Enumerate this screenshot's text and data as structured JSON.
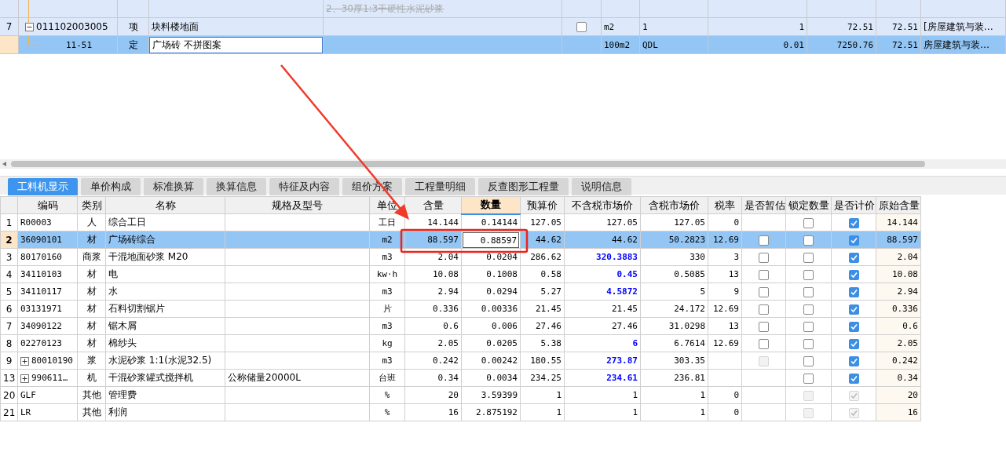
{
  "upper_table": {
    "rows": [
      {
        "kind": "partial",
        "description": "2、30厚1:3干硬性水泥砂浆"
      },
      {
        "kind": "item",
        "number": "7",
        "code": "011102003005",
        "expanded": true,
        "type": "项",
        "name": "块料楼地面",
        "checked": false,
        "unit": "m2",
        "expression": "1",
        "quantity": "1",
        "unit_price": "72.51",
        "total": "72.51",
        "specialty": "[房屋建筑与装…",
        "selected": false
      },
      {
        "kind": "quota",
        "code": "11-51",
        "type": "定",
        "name": "广场砖 不拼图案",
        "unit": "100m2",
        "expression": "QDL",
        "quantity": "0.01",
        "unit_price": "7250.76",
        "total": "72.51",
        "specialty": "房屋建筑与装…",
        "selected": true
      }
    ]
  },
  "tabs": [
    {
      "label": "工料机显示",
      "selected": true
    },
    {
      "label": "单价构成",
      "selected": false
    },
    {
      "label": "标准换算",
      "selected": false
    },
    {
      "label": "换算信息",
      "selected": false
    },
    {
      "label": "特征及内容",
      "selected": false
    },
    {
      "label": "组价方案",
      "selected": false
    },
    {
      "label": "工程量明细",
      "selected": false
    },
    {
      "label": "反查图形工程量",
      "selected": false
    },
    {
      "label": "说明信息",
      "selected": false
    }
  ],
  "resource_table": {
    "columns": [
      {
        "label": "编码",
        "selected": false
      },
      {
        "label": "类别",
        "selected": false
      },
      {
        "label": "名称",
        "selected": false
      },
      {
        "label": "规格及型号",
        "selected": false
      },
      {
        "label": "单位",
        "selected": false
      },
      {
        "label": "含量",
        "selected": false
      },
      {
        "label": "数量",
        "selected": true
      },
      {
        "label": "预算价",
        "selected": false
      },
      {
        "label": "不含税市场价",
        "selected": false
      },
      {
        "label": "含税市场价",
        "selected": false
      },
      {
        "label": "税率",
        "selected": false
      },
      {
        "label": "是否暂估",
        "selected": false
      },
      {
        "label": "锁定数量",
        "selected": false
      },
      {
        "label": "是否计价",
        "selected": false
      },
      {
        "label": "原始含量",
        "selected": false
      }
    ],
    "rows": [
      {
        "number": "1",
        "code": "R00003",
        "expandable": false,
        "type": "人",
        "name": "综合工日",
        "unit": "工日",
        "content": "14.144",
        "quantity": "0.14144",
        "budget_price": "127.05",
        "market_price": "127.05",
        "market_changed": false,
        "market_price_tax": "127.05",
        "tax_rate": "0",
        "lock": {
          "checked": false,
          "disabled": false
        },
        "priced": {
          "checked": true,
          "disabled": false
        },
        "original": "14.144",
        "selected": false
      },
      {
        "number": "2",
        "code": "36090101",
        "expandable": false,
        "type": "材",
        "name": "广场砖综合",
        "unit": "m2",
        "content": "88.597",
        "quantity": "0.88597",
        "budget_price": "44.62",
        "market_price": "44.62",
        "market_changed": false,
        "market_price_tax": "50.2823",
        "tax_rate": "12.69",
        "estimate": {
          "checked": false,
          "disabled": false
        },
        "lock": {
          "checked": false,
          "disabled": false
        },
        "priced": {
          "checked": true,
          "disabled": false
        },
        "original": "88.597",
        "selected": true
      },
      {
        "number": "3",
        "code": "80170160",
        "expandable": false,
        "type": "商浆",
        "name": "干混地面砂浆 M20",
        "unit": "m3",
        "content": "2.04",
        "quantity": "0.0204",
        "budget_price": "286.62",
        "market_price": "320.3883",
        "market_changed": true,
        "market_price_tax": "330",
        "tax_rate": "3",
        "estimate": {
          "checked": false,
          "disabled": false
        },
        "lock": {
          "checked": false,
          "disabled": false
        },
        "priced": {
          "checked": true,
          "disabled": false
        },
        "original": "2.04",
        "selected": false
      },
      {
        "number": "4",
        "code": "34110103",
        "expandable": false,
        "type": "材",
        "name": "电",
        "unit": "kw·h",
        "content": "10.08",
        "quantity": "0.1008",
        "budget_price": "0.58",
        "market_price": "0.45",
        "market_changed": true,
        "market_price_tax": "0.5085",
        "tax_rate": "13",
        "estimate": {
          "checked": false,
          "disabled": false
        },
        "lock": {
          "checked": false,
          "disabled": false
        },
        "priced": {
          "checked": true,
          "disabled": false
        },
        "original": "10.08",
        "selected": false
      },
      {
        "number": "5",
        "code": "34110117",
        "expandable": false,
        "type": "材",
        "name": "水",
        "unit": "m3",
        "content": "2.94",
        "quantity": "0.0294",
        "budget_price": "5.27",
        "market_price": "4.5872",
        "market_changed": true,
        "market_price_tax": "5",
        "tax_rate": "9",
        "estimate": {
          "checked": false,
          "disabled": false
        },
        "lock": {
          "checked": false,
          "disabled": false
        },
        "priced": {
          "checked": true,
          "disabled": false
        },
        "original": "2.94",
        "selected": false
      },
      {
        "number": "6",
        "code": "03131971",
        "expandable": false,
        "type": "材",
        "name": "石料切割锯片",
        "unit": "片",
        "content": "0.336",
        "quantity": "0.00336",
        "budget_price": "21.45",
        "market_price": "21.45",
        "market_changed": false,
        "market_price_tax": "24.172",
        "tax_rate": "12.69",
        "estimate": {
          "checked": false,
          "disabled": false
        },
        "lock": {
          "checked": false,
          "disabled": false
        },
        "priced": {
          "checked": true,
          "disabled": false
        },
        "original": "0.336",
        "selected": false
      },
      {
        "number": "7",
        "code": "34090122",
        "expandable": false,
        "type": "材",
        "name": "锯木屑",
        "unit": "m3",
        "content": "0.6",
        "quantity": "0.006",
        "budget_price": "27.46",
        "market_price": "27.46",
        "market_changed": false,
        "market_price_tax": "31.0298",
        "tax_rate": "13",
        "estimate": {
          "checked": false,
          "disabled": false
        },
        "lock": {
          "checked": false,
          "disabled": false
        },
        "priced": {
          "checked": true,
          "disabled": false
        },
        "original": "0.6",
        "selected": false
      },
      {
        "number": "8",
        "code": "02270123",
        "expandable": false,
        "type": "材",
        "name": "棉纱头",
        "unit": "kg",
        "content": "2.05",
        "quantity": "0.0205",
        "budget_price": "5.38",
        "market_price": "6",
        "market_changed": true,
        "market_price_tax": "6.7614",
        "tax_rate": "12.69",
        "estimate": {
          "checked": false,
          "disabled": false
        },
        "lock": {
          "checked": false,
          "disabled": false
        },
        "priced": {
          "checked": true,
          "disabled": false
        },
        "original": "2.05",
        "selected": false
      },
      {
        "number": "9",
        "code": "80010190",
        "expandable": true,
        "type": "浆",
        "name": "水泥砂浆 1:1(水泥32.5)",
        "unit": "m3",
        "content": "0.242",
        "quantity": "0.00242",
        "budget_price": "180.55",
        "market_price": "273.87",
        "market_changed": true,
        "market_price_tax": "303.35",
        "estimate": {
          "checked": false,
          "disabled": true
        },
        "lock": {
          "checked": false,
          "disabled": false
        },
        "priced": {
          "checked": true,
          "disabled": false
        },
        "original": "0.242",
        "selected": false
      },
      {
        "number": "13",
        "code": "990611…",
        "expandable": true,
        "type": "机",
        "name": "干混砂浆罐式搅拌机",
        "spec": "公称储量20000L",
        "unit": "台班",
        "content": "0.34",
        "quantity": "0.0034",
        "budget_price": "234.25",
        "market_price": "234.61",
        "market_changed": true,
        "market_price_tax": "236.81",
        "lock": {
          "checked": false,
          "disabled": false
        },
        "priced": {
          "checked": true,
          "disabled": false
        },
        "original": "0.34",
        "selected": false
      },
      {
        "number": "20",
        "code": "GLF",
        "expandable": false,
        "type": "其他",
        "name": "管理费",
        "unit": "%",
        "content": "20",
        "quantity": "3.59399",
        "budget_price": "1",
        "market_price": "1",
        "market_changed": false,
        "market_price_tax": "1",
        "tax_rate": "0",
        "lock": {
          "checked": false,
          "disabled": true
        },
        "priced": {
          "checked": true,
          "disabled": true
        },
        "original": "20",
        "selected": false
      },
      {
        "number": "21",
        "code": "LR",
        "expandable": false,
        "type": "其他",
        "name": "利润",
        "unit": "%",
        "content": "16",
        "quantity": "2.875192",
        "budget_price": "1",
        "market_price": "1",
        "market_changed": false,
        "market_price_tax": "1",
        "tax_rate": "0",
        "lock": {
          "checked": false,
          "disabled": true
        },
        "priced": {
          "checked": true,
          "disabled": true
        },
        "original": "16",
        "selected": false
      }
    ]
  }
}
